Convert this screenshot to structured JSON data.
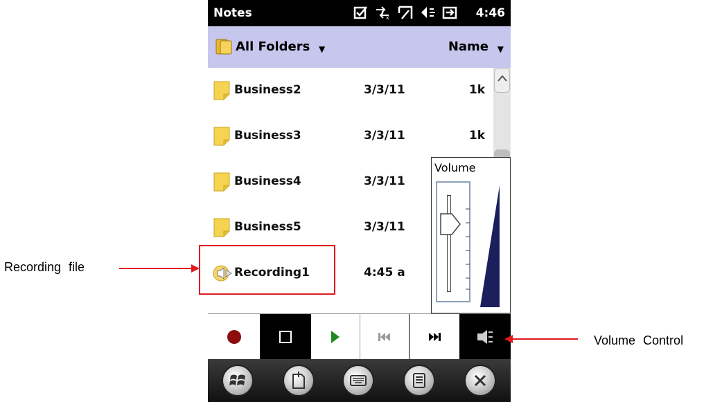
{
  "status_bar": {
    "title": "Notes",
    "clock": "4:46",
    "icons": [
      "checkbox-icon",
      "connectivity-icon",
      "signal-icon",
      "speaker-icon",
      "battery-icon"
    ]
  },
  "folder_bar": {
    "folder_label": "All Folders",
    "sort_label": "Name"
  },
  "files": [
    {
      "name": "Business2",
      "date": "3/3/11",
      "size": "1k",
      "type": "note"
    },
    {
      "name": "Business3",
      "date": "3/3/11",
      "size": "1k",
      "type": "note"
    },
    {
      "name": "Business4",
      "date": "3/3/11",
      "size": "",
      "type": "note"
    },
    {
      "name": "Business5",
      "date": "3/3/11",
      "size": "",
      "type": "note"
    },
    {
      "name": "Recording1",
      "date": "4:45 a",
      "size": "",
      "type": "recording"
    }
  ],
  "volume_panel": {
    "title": "Volume"
  },
  "controls": [
    "record-icon",
    "stop-icon",
    "play-icon",
    "previous-icon",
    "next-icon",
    "volume-control-icon"
  ],
  "taskbar": [
    "start-icon",
    "new-note-icon",
    "keyboard-icon",
    "menu-icon",
    "close-icon"
  ],
  "annotations": {
    "recording_label": "Recording file",
    "volume_label": "Volume Control"
  },
  "colors": {
    "folder_bar_bg": "#c7c7ee",
    "annotation_red": "#e0191f",
    "record_red": "#8b0d0d",
    "play_green": "#1f8a1f",
    "note_yellow": "#f5d451"
  }
}
